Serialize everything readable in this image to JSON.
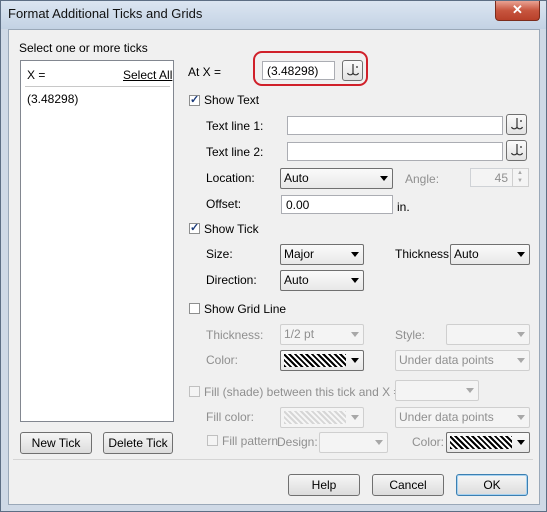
{
  "window": {
    "title": "Format Additional Ticks and Grids",
    "close_glyph": "✕"
  },
  "ticks_panel": {
    "heading": "Select one or more ticks",
    "list_header_x": "X =",
    "select_all": "Select All",
    "items": [
      "(3.48298)"
    ],
    "new_tick_label": "New Tick",
    "delete_tick_label": "Delete Tick"
  },
  "at_x": {
    "label": "At X =",
    "value": "(3.48298)"
  },
  "show_text": {
    "label": "Show Text",
    "checked": true,
    "text_line_1_label": "Text line 1:",
    "text_line_1_value": "",
    "text_line_2_label": "Text line 2:",
    "text_line_2_value": "",
    "location_label": "Location:",
    "location_value": "Auto",
    "angle_label": "Angle:",
    "angle_value": "45",
    "offset_label": "Offset:",
    "offset_value": "0.00",
    "offset_unit": "in."
  },
  "show_tick": {
    "label": "Show Tick",
    "checked": true,
    "size_label": "Size:",
    "size_value": "Major",
    "thickness_label": "Thickness:",
    "thickness_value": "Auto",
    "direction_label": "Direction:",
    "direction_value": "Auto"
  },
  "show_grid_line": {
    "label": "Show Grid Line",
    "checked": false,
    "thickness_label": "Thickness:",
    "thickness_value": "1/2 pt",
    "style_label": "Style:",
    "style_value": "",
    "color_label": "Color:",
    "placement_value": "Under data points"
  },
  "fill_shade": {
    "label": "Fill (shade) between this tick and X =",
    "checked": false,
    "x_value": "",
    "fill_color_label": "Fill color:",
    "placement_value": "Under data points",
    "fill_pattern_label": "Fill pattern",
    "fill_pattern_checked": false,
    "design_label": "Design:",
    "design_value": "",
    "color_label": "Color:"
  },
  "footer": {
    "help_label": "Help",
    "cancel_label": "Cancel",
    "ok_label": "OK"
  },
  "colors": {
    "highlight_ring": "#d0202a",
    "title_bar": "#c3d2e4",
    "dialog_bg": "#f0f0f0"
  }
}
